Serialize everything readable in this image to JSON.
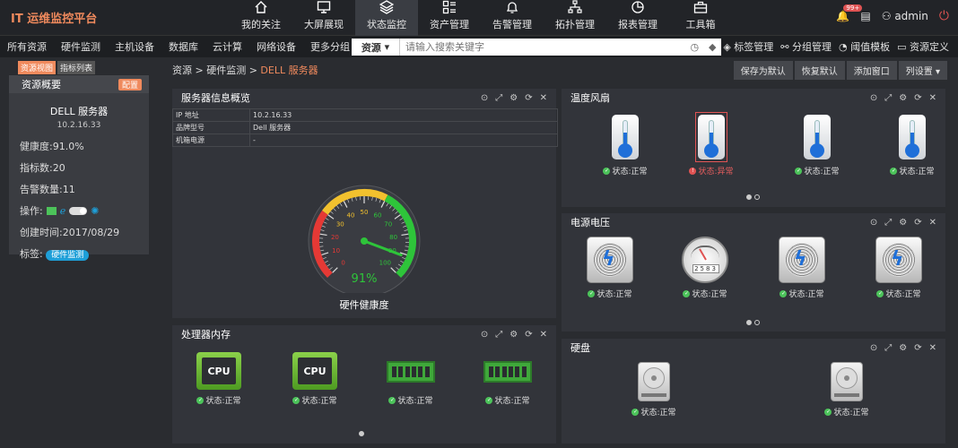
{
  "app": {
    "title": "IT 运维监控平台"
  },
  "nav": [
    {
      "label": "我的关注",
      "icon": "home-icon"
    },
    {
      "label": "大屏展现",
      "icon": "monitor-icon"
    },
    {
      "label": "状态监控",
      "icon": "layers-icon"
    },
    {
      "label": "资产管理",
      "icon": "grid-list-icon"
    },
    {
      "label": "告警管理",
      "icon": "bell-icon"
    },
    {
      "label": "拓扑管理",
      "icon": "topology-icon"
    },
    {
      "label": "报表管理",
      "icon": "pie-chart-icon"
    },
    {
      "label": "工具箱",
      "icon": "toolbox-icon"
    }
  ],
  "header": {
    "badge": "99+",
    "user": "admin"
  },
  "menu": [
    "所有资源",
    "硬件监测",
    "主机设备",
    "数据库",
    "云计算",
    "网络设备",
    "更多分组 ▾"
  ],
  "search": {
    "type_label": "资源",
    "placeholder": "请输入搜索关键字"
  },
  "menu_right": [
    "标签管理",
    "分组管理",
    "阈值模板",
    "资源定义"
  ],
  "sidebar": {
    "tabs": [
      "资源视图",
      "指标列表"
    ],
    "title": "资源概要",
    "config_label": "配置",
    "device_name": "DELL 服务器",
    "device_ip": "10.2.16.33",
    "health": "健康度:91.0%",
    "metrics": "指标数:20",
    "alarms": "告警数量:11",
    "ops_label": "操作:",
    "created": "创建时间:2017/08/29",
    "tag_label": "标签:",
    "tag": "硬件监测"
  },
  "breadcrumb": {
    "path": "资源 > 硬件监测 > ",
    "current": "DELL 服务器"
  },
  "actions": [
    "保存为默认",
    "恢复默认",
    "添加窗口",
    "列设置 ▾"
  ],
  "server_panel": {
    "title": "服务器信息概览",
    "rows": [
      [
        "IP 地址",
        "10.2.16.33"
      ],
      [
        "品牌型号",
        "Dell 服务器"
      ],
      [
        "机箱电源",
        "-"
      ]
    ],
    "gauge_ticks": [
      "0",
      "10",
      "20",
      "30",
      "40",
      "50",
      "60",
      "70",
      "80",
      "90",
      "100"
    ],
    "gauge_value": 91,
    "gauge_text": "91%",
    "gauge_label": "硬件健康度"
  },
  "temp_panel": {
    "title": "温度风扇",
    "items": [
      {
        "status": "状态:正常",
        "state": "ok"
      },
      {
        "status": "状态:异常",
        "state": "err"
      },
      {
        "status": "状态:正常",
        "state": "ok"
      },
      {
        "status": "状态:正常",
        "state": "ok"
      }
    ]
  },
  "power_panel": {
    "title": "电源电压",
    "meter_digits": "2583",
    "items": [
      {
        "status": "状态:正常",
        "kind": "fan"
      },
      {
        "status": "状态:正常",
        "kind": "meter"
      },
      {
        "status": "状态:正常",
        "kind": "fan"
      },
      {
        "status": "状态:正常",
        "kind": "fan"
      }
    ]
  },
  "cpu_panel": {
    "title": "处理器内存",
    "chip_label": "CPU",
    "items": [
      {
        "status": "状态:正常",
        "kind": "cpu"
      },
      {
        "status": "状态:正常",
        "kind": "cpu"
      },
      {
        "status": "状态:正常",
        "kind": "ram"
      },
      {
        "status": "状态:正常",
        "kind": "ram"
      }
    ]
  },
  "disk_panel": {
    "title": "硬盘",
    "items": [
      {
        "status": "状态:正常"
      },
      {
        "status": "状态:正常"
      }
    ]
  },
  "colors": {
    "accent": "#f08a5d",
    "ok": "#4cc35a",
    "err": "#e05353",
    "gauge_green": "#2ec43a",
    "tag": "#1e9fd8"
  }
}
